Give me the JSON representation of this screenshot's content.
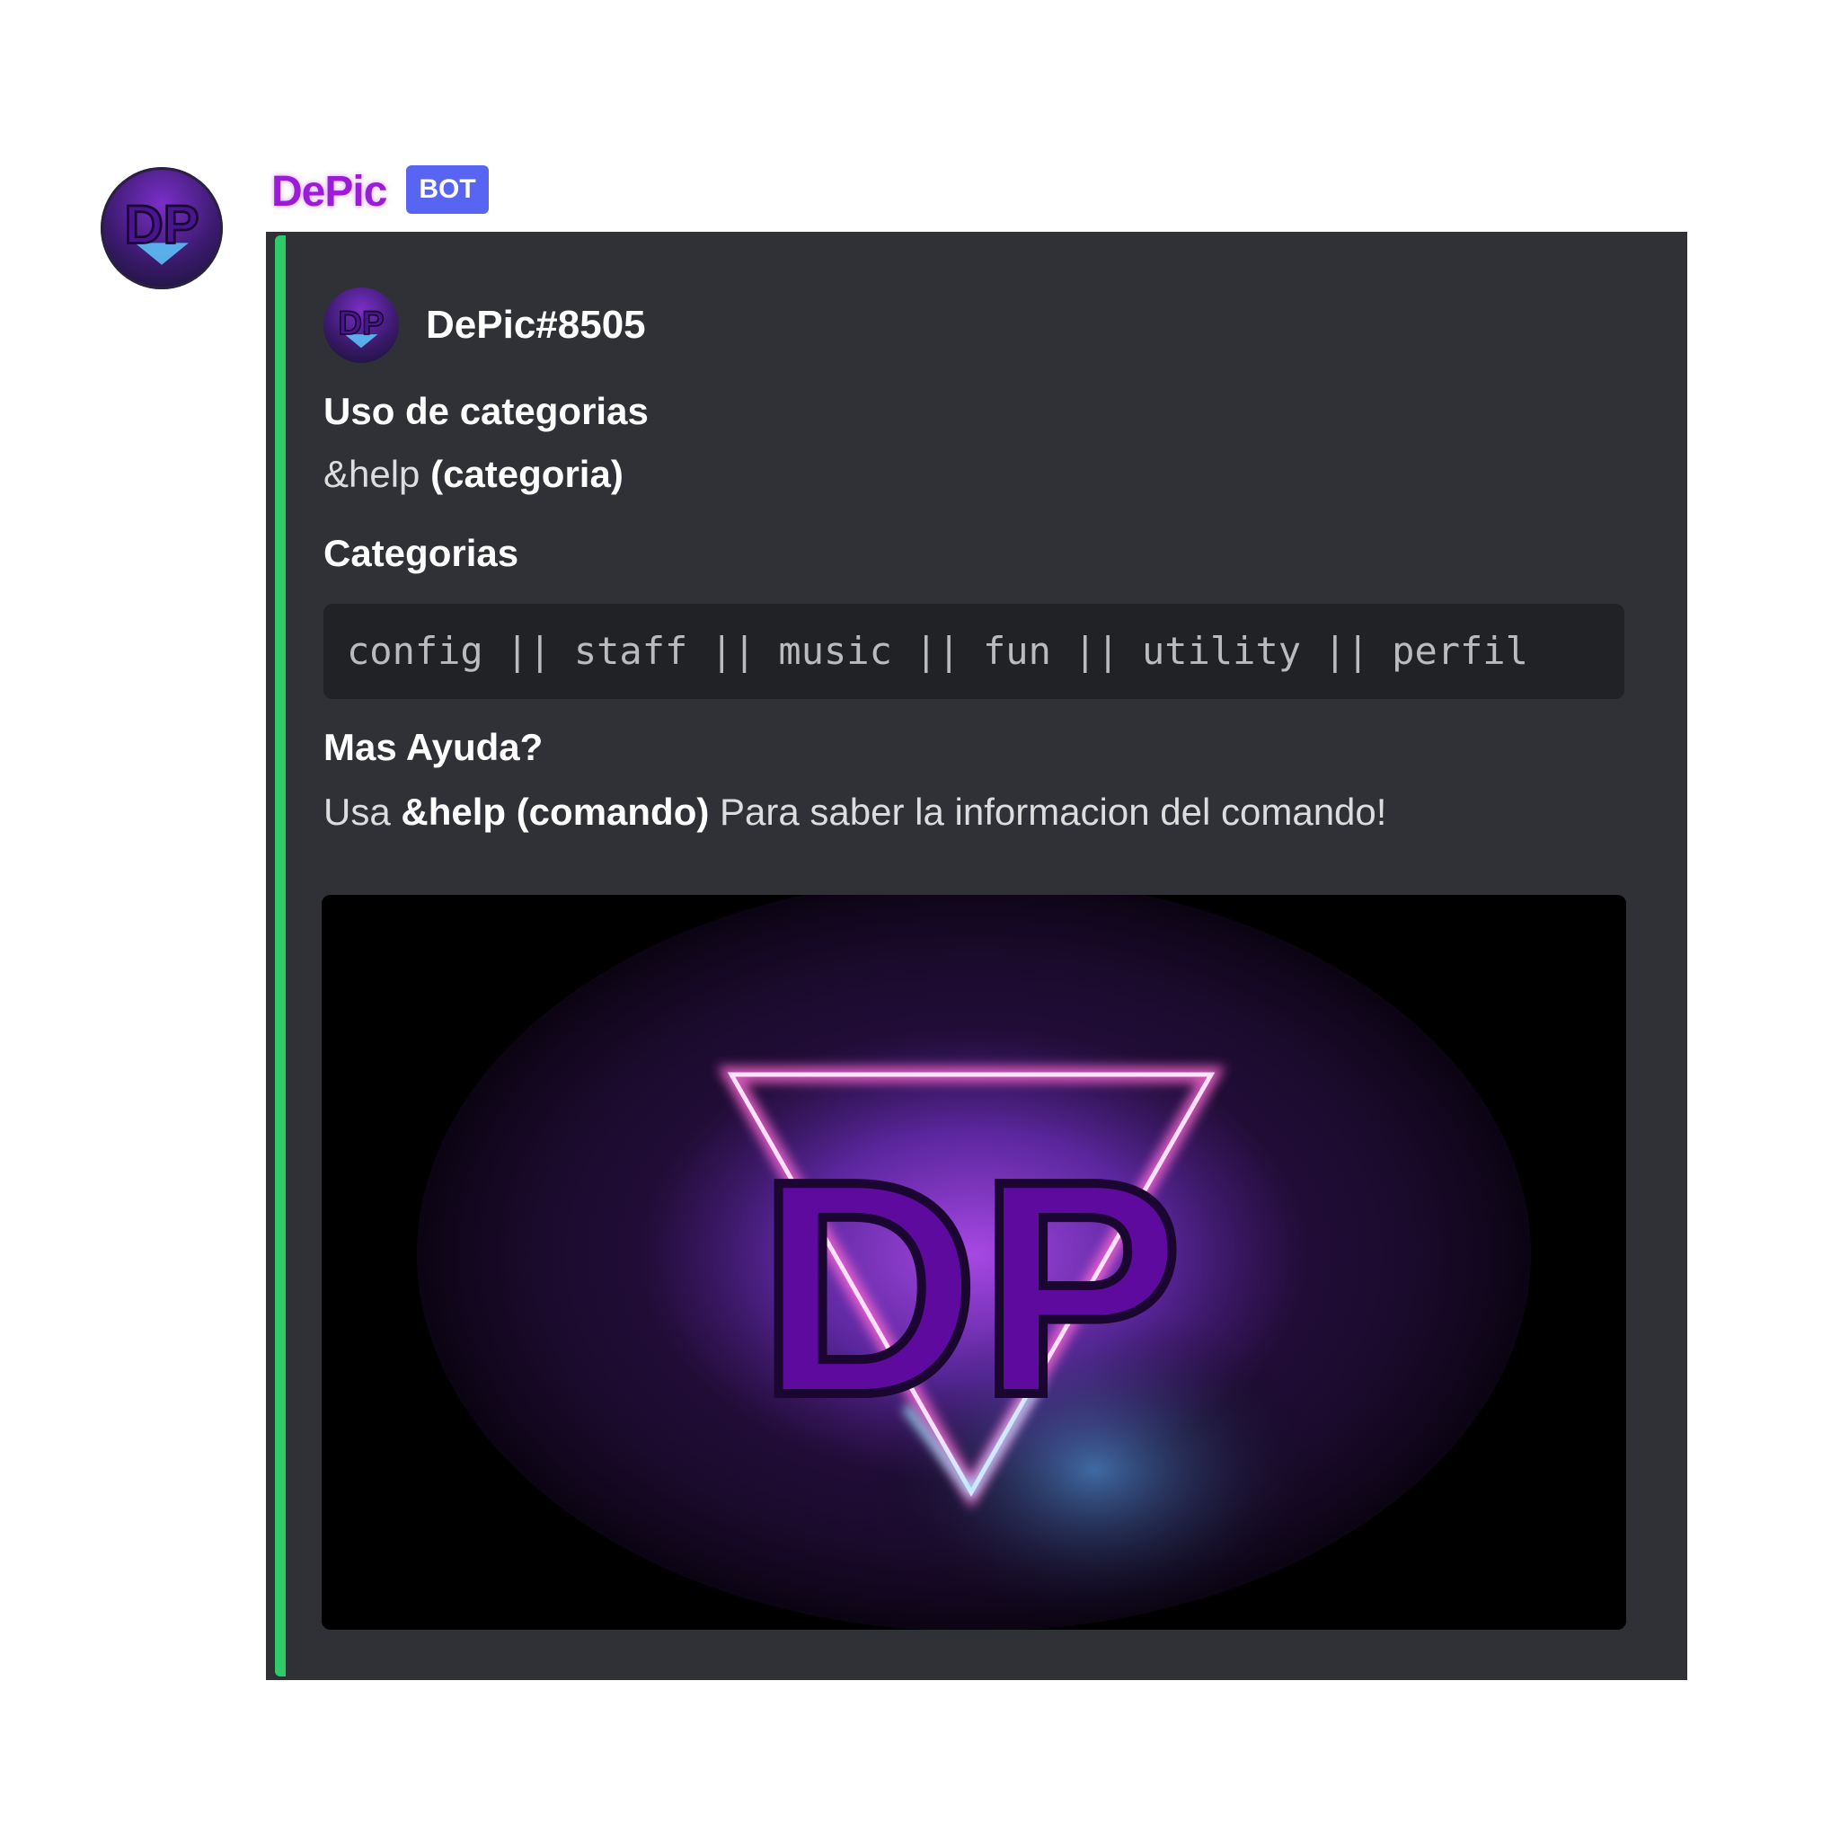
{
  "message": {
    "author": {
      "display_name": "DePic",
      "bot_tag": "BOT",
      "avatar_icon": "dp-logo-avatar-icon",
      "display_name_color": "#9b1bd8"
    }
  },
  "embed": {
    "accent_color": "#2fcb6a",
    "author": {
      "name": "DePic#8505",
      "icon": "dp-logo-avatar-icon"
    },
    "fields": [
      {
        "name": "Uso de categorias",
        "value_prefix": "&help ",
        "value_bold": "(categoria)"
      },
      {
        "name": "Categorias",
        "code": "config || staff || music || fun || utility || perfil"
      },
      {
        "name": "Mas Ayuda?",
        "value_prefix": "Usa ",
        "value_bold": "&help (comando)",
        "value_suffix": " Para saber la informacion del comando!"
      }
    ],
    "image": {
      "icon": "dp-neon-logo-image",
      "logo_text": "DP"
    }
  }
}
